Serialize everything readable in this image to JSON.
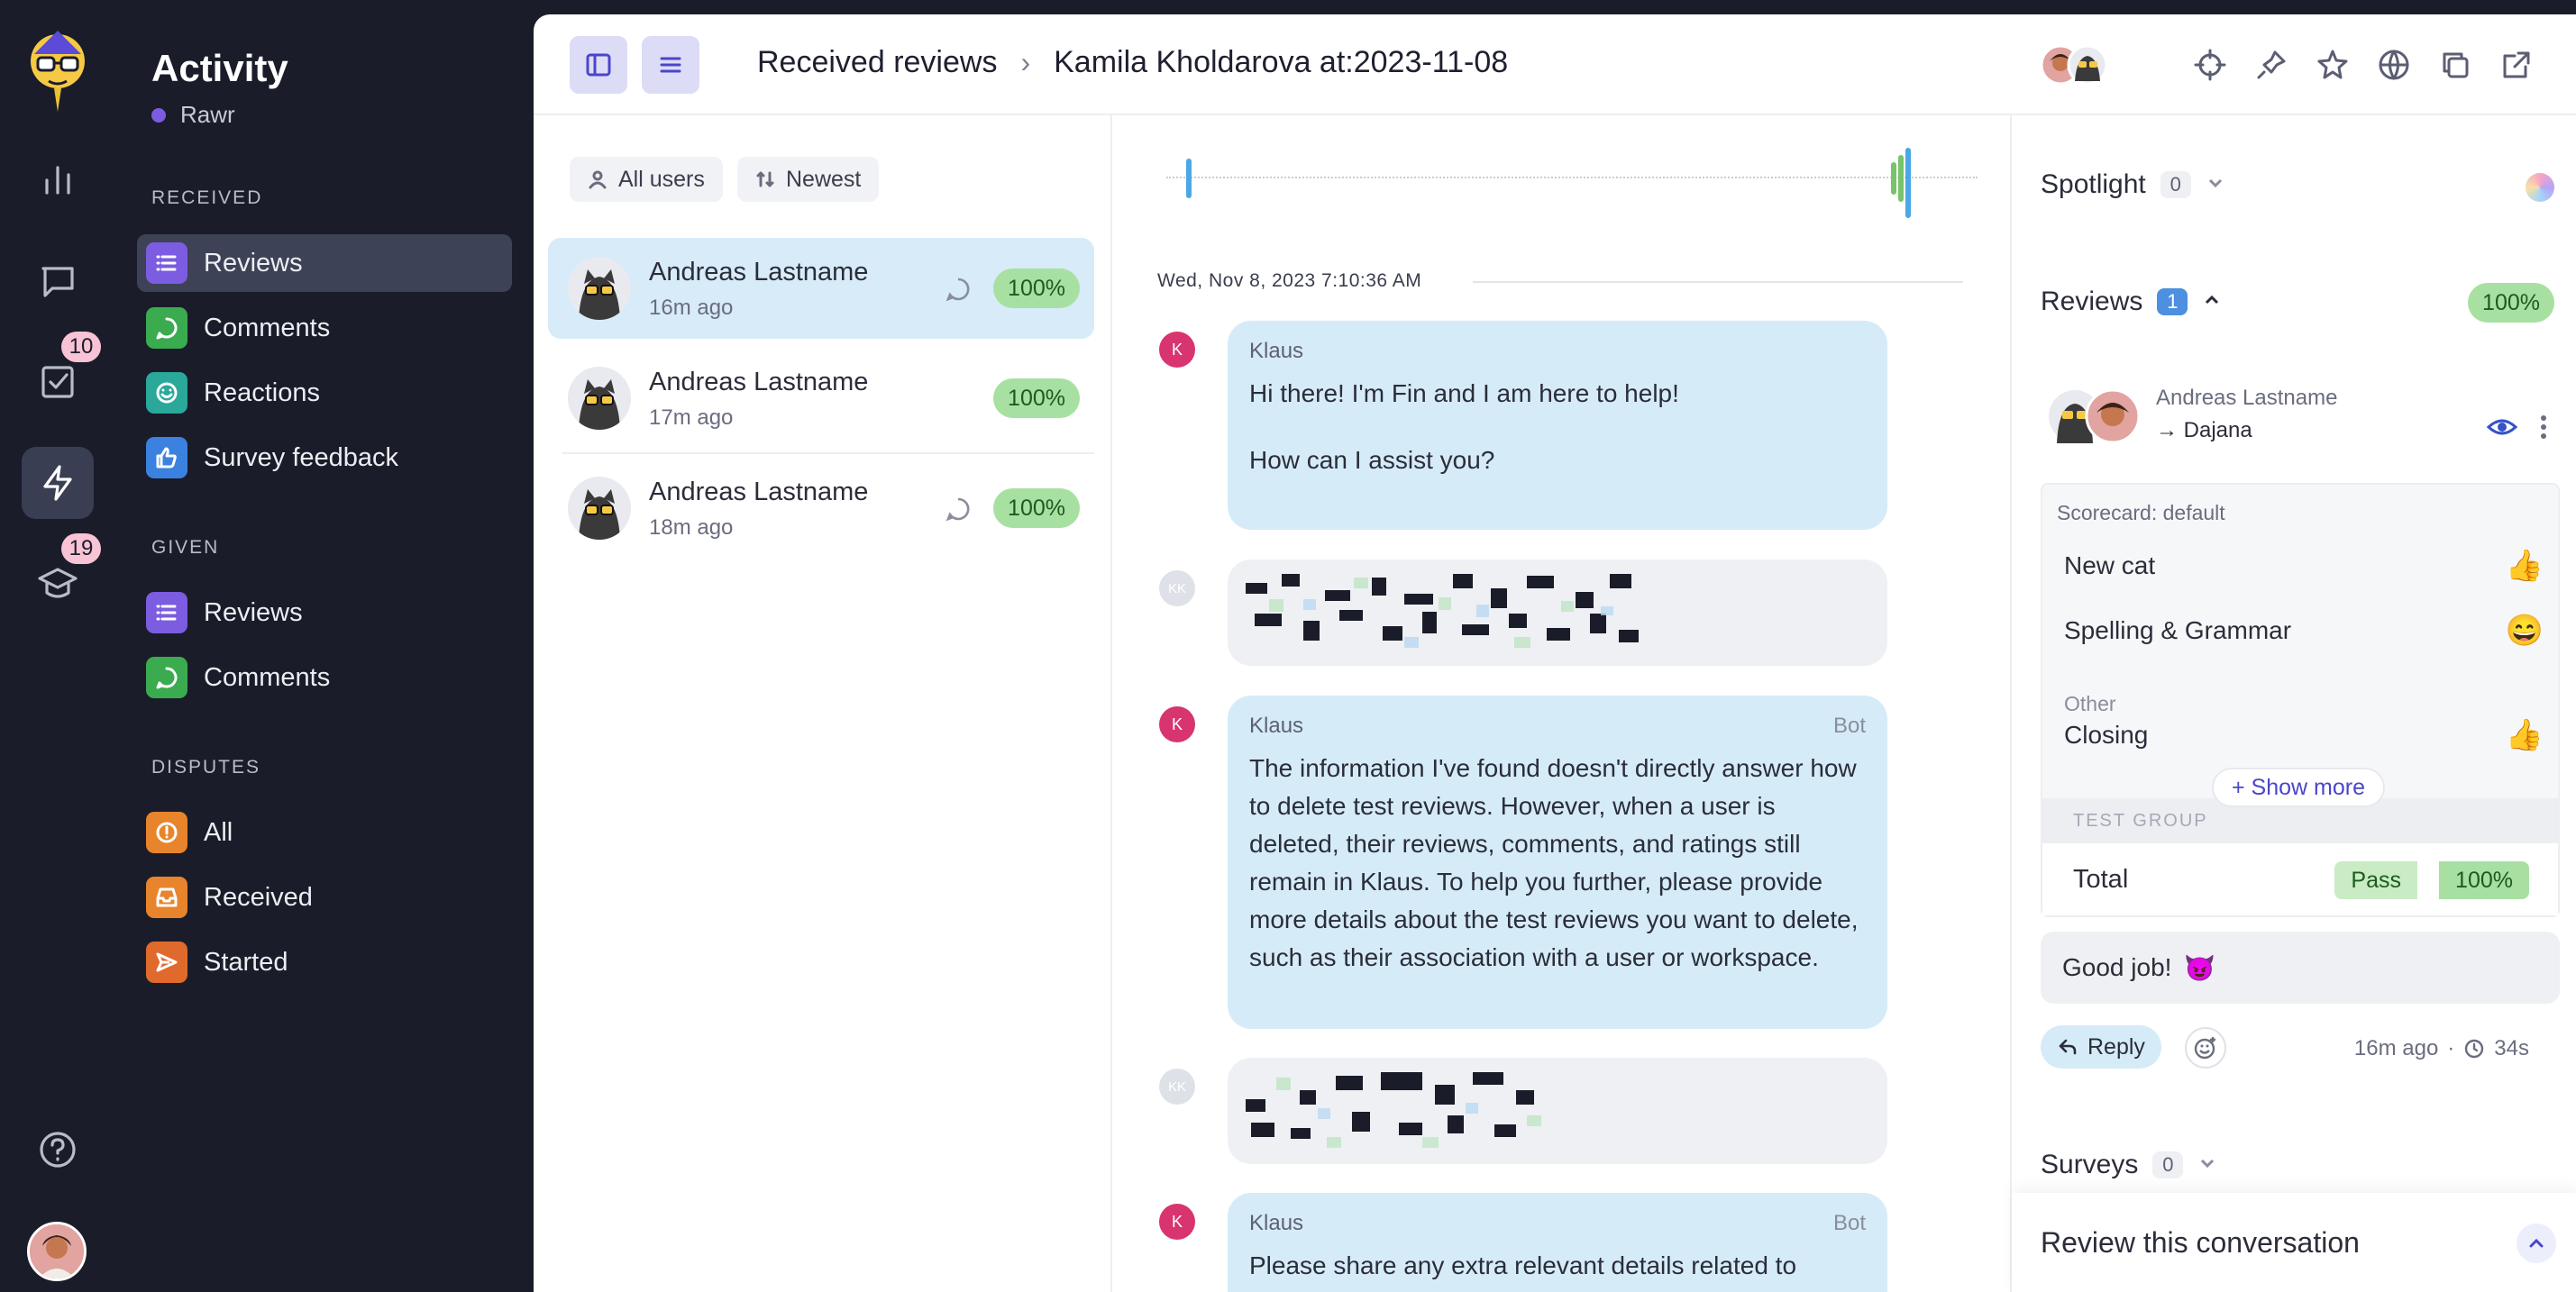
{
  "rail": {
    "items": [
      {
        "name": "stats-icon"
      },
      {
        "name": "conversations-icon"
      },
      {
        "name": "tasks-icon",
        "badge": "10"
      },
      {
        "name": "activity-icon",
        "active": true
      },
      {
        "name": "coaching-icon",
        "badge": "19"
      }
    ]
  },
  "sidebar": {
    "title": "Activity",
    "workspace": "Rawr",
    "sections": {
      "received": "RECEIVED",
      "given": "GIVEN",
      "disputes": "DISPUTES"
    },
    "received_items": [
      {
        "label": "Reviews",
        "color": "#7c5ce0"
      },
      {
        "label": "Comments",
        "color": "#3bab4f"
      },
      {
        "label": "Reactions",
        "color": "#2aa89a"
      },
      {
        "label": "Survey feedback",
        "color": "#3b82e0"
      }
    ],
    "given_items": [
      {
        "label": "Reviews",
        "color": "#7c5ce0"
      },
      {
        "label": "Comments",
        "color": "#3bab4f"
      }
    ],
    "dispute_items": [
      {
        "label": "All",
        "color": "#e8842c"
      },
      {
        "label": "Received",
        "color": "#e8842c"
      },
      {
        "label": "Started",
        "color": "#e06a2c"
      }
    ]
  },
  "topbar": {
    "crumb_1": "Received reviews",
    "crumb_2": "Kamila Kholdarova at:2023-11-08"
  },
  "list": {
    "filter_users": "All users",
    "filter_sort": "Newest",
    "rows": [
      {
        "name": "Andreas Lastname",
        "time": "16m ago",
        "score": "100%"
      },
      {
        "name": "Andreas Lastname",
        "time": "17m ago",
        "score": "100%"
      },
      {
        "name": "Andreas Lastname",
        "time": "18m ago",
        "score": "100%"
      }
    ]
  },
  "conversation": {
    "date": "Wed, Nov 8, 2023 7:10:36 AM",
    "messages": [
      {
        "avatar": "K",
        "author": "Klaus",
        "bot": "",
        "text_1": "Hi there! I'm Fin and I am here to help!",
        "text_2": "How can I assist you?"
      },
      {
        "avatar": "KK"
      },
      {
        "avatar": "K",
        "author": "Klaus",
        "bot": "Bot",
        "text": "The information I've found doesn't directly answer how to delete test reviews. However, when a user is deleted, their reviews, comments, and ratings still remain in Klaus. To help you further, please provide more details about the test reviews you want to delete, such as their association with a user or workspace."
      },
      {
        "avatar": "KK"
      },
      {
        "avatar": "K",
        "author": "Klaus",
        "bot": "Bot",
        "text": "Please share any extra relevant details related to"
      }
    ]
  },
  "panel": {
    "spotlight": "Spotlight",
    "spotlight_count": "0",
    "reviews": "Reviews",
    "reviews_count": "1",
    "reviews_score": "100%",
    "reviewer": "Andreas Lastname",
    "reviewee": "→ Dajana",
    "scorecard_title": "Scorecard: default",
    "categories": [
      {
        "label": "New cat",
        "emoji": "👍"
      },
      {
        "label": "Spelling & Grammar",
        "emoji": "😄"
      }
    ],
    "other_label": "Other",
    "other_categories": [
      {
        "label": "Closing",
        "emoji": "👍"
      }
    ],
    "show_more": "+ Show more",
    "test_group": "TEST GROUP",
    "total_label": "Total",
    "total_pass": "Pass",
    "total_pct": "100%",
    "comment": "Good job!",
    "comment_emoji": "😈",
    "reply": "Reply",
    "time_ago": "16m ago",
    "separator": "·",
    "duration": "34s",
    "surveys": "Surveys",
    "surveys_count": "0",
    "review_this": "Review this conversation"
  }
}
